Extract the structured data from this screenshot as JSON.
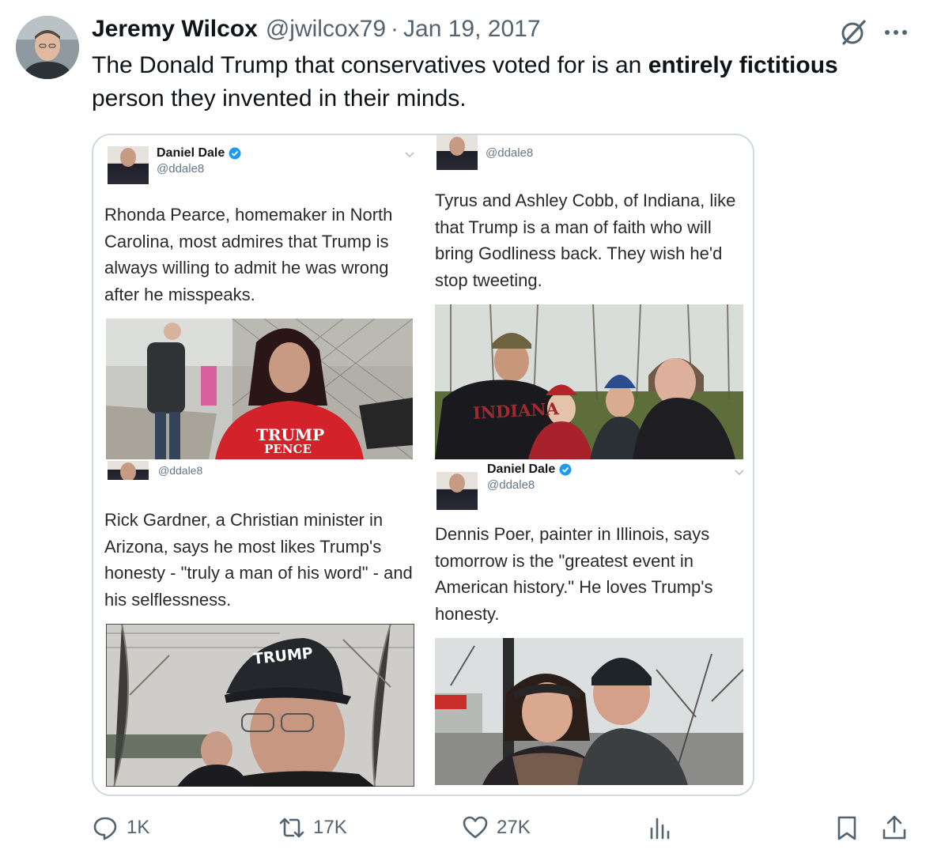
{
  "post": {
    "author_name": "Jeremy Wilcox",
    "handle": "@jwilcox79",
    "separator": "·",
    "date": "Jan 19, 2017",
    "text_before": "The Donald Trump that conservatives voted for is an ",
    "text_bold": "entirely fictitious",
    "text_after": " person they invented in their minds."
  },
  "embedded": {
    "top_left": {
      "name": "Daniel Dale",
      "handle": "@ddale8",
      "text": "Rhonda Pearce, homemaker in North Carolina, most admires that Trump is always willing to admit he was wrong after he misspeaks.",
      "shirt_line1": "TRUMP",
      "shirt_line2": "PENCE"
    },
    "top_right": {
      "handle": "@ddale8",
      "text": "Tyrus and Ashley Cobb, of Indiana, like that Trump is a man of faith who will bring Godliness back. They wish he'd stop tweeting.",
      "shirt": "INDIANA"
    },
    "bottom_left": {
      "handle": "@ddale8",
      "text": "Rick Gardner, a Christian minister in Arizona, says he most likes Trump's honesty - \"truly a man of his word\" - and his selflessness.",
      "hat": "TRUMP"
    },
    "bottom_right": {
      "name": "Daniel Dale",
      "handle": "@ddale8",
      "text": "Dennis Poer, painter in Illinois, says tomorrow is the \"greatest event in American history.\" He loves Trump's honesty."
    }
  },
  "actions": {
    "replies": "1K",
    "reposts": "17K",
    "likes": "27K"
  },
  "icons": [
    "grok-icon",
    "more-icon",
    "reply-icon",
    "repost-icon",
    "like-icon",
    "views-icon",
    "bookmark-icon",
    "share-icon",
    "verified-icon"
  ],
  "colors": {
    "text": "#0f1419",
    "secondary": "#536471",
    "border": "#cfd9de",
    "verified": "#1d9bf0"
  }
}
